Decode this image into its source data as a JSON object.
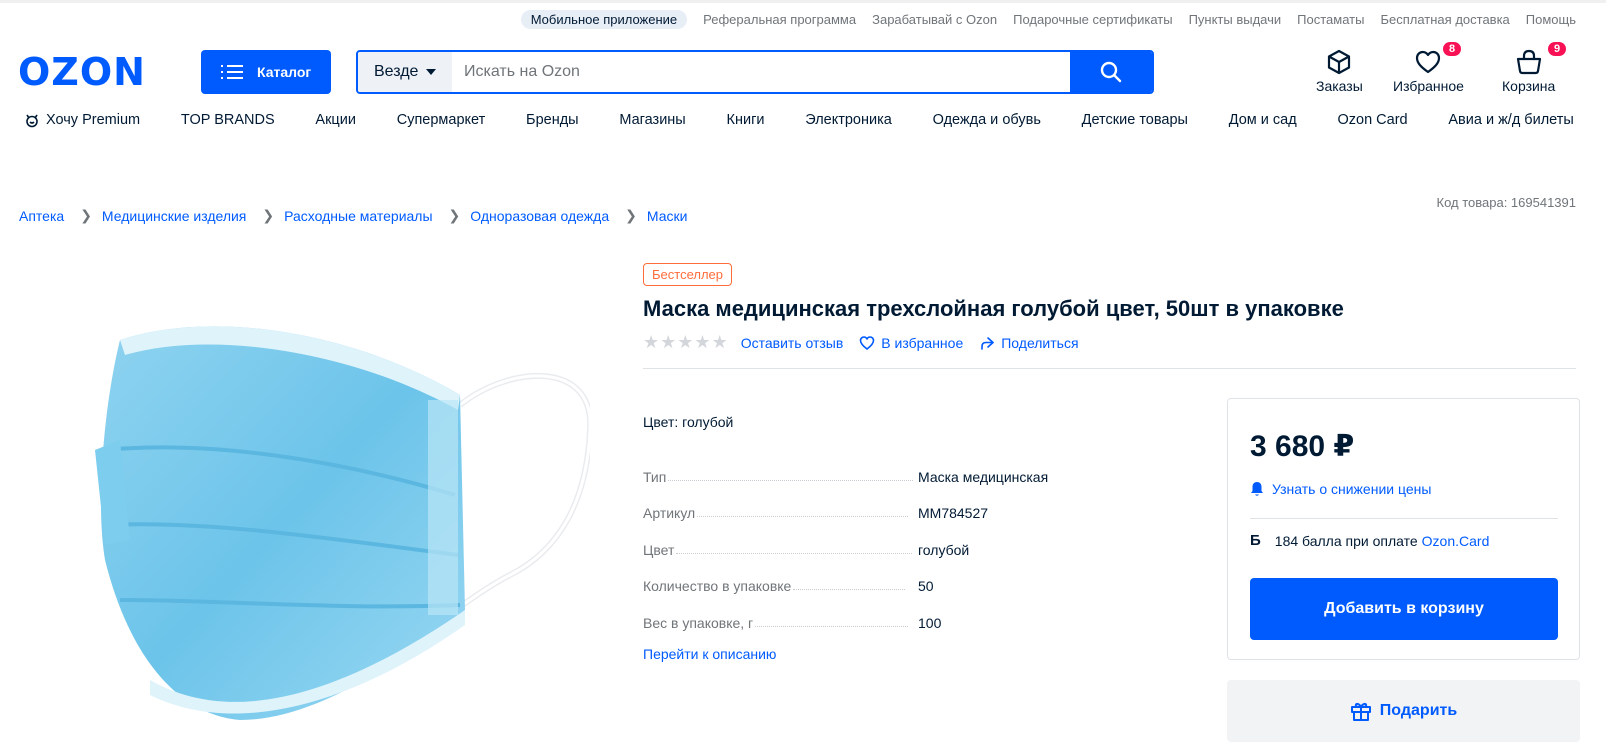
{
  "top_links": {
    "mobile_app": "Мобильное приложение",
    "items": [
      "Реферальная программа",
      "Зарабатывай с Ozon",
      "Подарочные сертификаты",
      "Пункты выдачи",
      "Постаматы",
      "Бесплатная доставка",
      "Помощь"
    ]
  },
  "header": {
    "logo": "OZON",
    "catalog_label": "Каталог",
    "search_scope": "Везде",
    "search_placeholder": "Искать на Ozon",
    "orders_label": "Заказы",
    "favorites_label": "Избранное",
    "favorites_count": "8",
    "cart_label": "Корзина",
    "cart_count": "9"
  },
  "category_nav": [
    "Хочу Premium",
    "TOP BRANDS",
    "Акции",
    "Супермаркет",
    "Бренды",
    "Магазины",
    "Книги",
    "Электроника",
    "Одежда и обувь",
    "Детские товары",
    "Дом и сад",
    "Ozon Card",
    "Авиа и ж/д билеты"
  ],
  "breadcrumbs": [
    "Аптека",
    "Медицинские изделия",
    "Расходные материалы",
    "Одноразовая одежда",
    "Маски"
  ],
  "sku_text": "Код товара: 169541391",
  "product": {
    "badge": "Бестселлер",
    "title": "Маска медицинская трехслойная голубой цвет, 50шт в упаковке",
    "review_link": "Оставить отзыв",
    "favorite_link": "В избранное",
    "share_link": "Поделиться",
    "color_line": "Цвет: голубой",
    "specs": [
      {
        "key": "Тип",
        "value": "Маска медицинская"
      },
      {
        "key": "Артикул",
        "value": "MM784527"
      },
      {
        "key": "Цвет",
        "value": "голубой"
      },
      {
        "key": "Количество в упаковке",
        "value": "50"
      },
      {
        "key": "Вес в упаковке, г",
        "value": "100"
      }
    ],
    "description_link": "Перейти к описанию",
    "image_alt": "Медицинская маска"
  },
  "buy_box": {
    "price": "3 680 ₽",
    "price_alert": "Узнать о снижении цены",
    "bonus_icon": "Б",
    "bonus_text": "184 балла при оплате",
    "bonus_card": "Ozon.Card",
    "add_to_cart": "Добавить в корзину",
    "gift": "Подарить"
  },
  "colors": {
    "brand_blue": "#005bff",
    "badge_red": "#f91155",
    "bestseller_orange": "#ff6d3b"
  }
}
